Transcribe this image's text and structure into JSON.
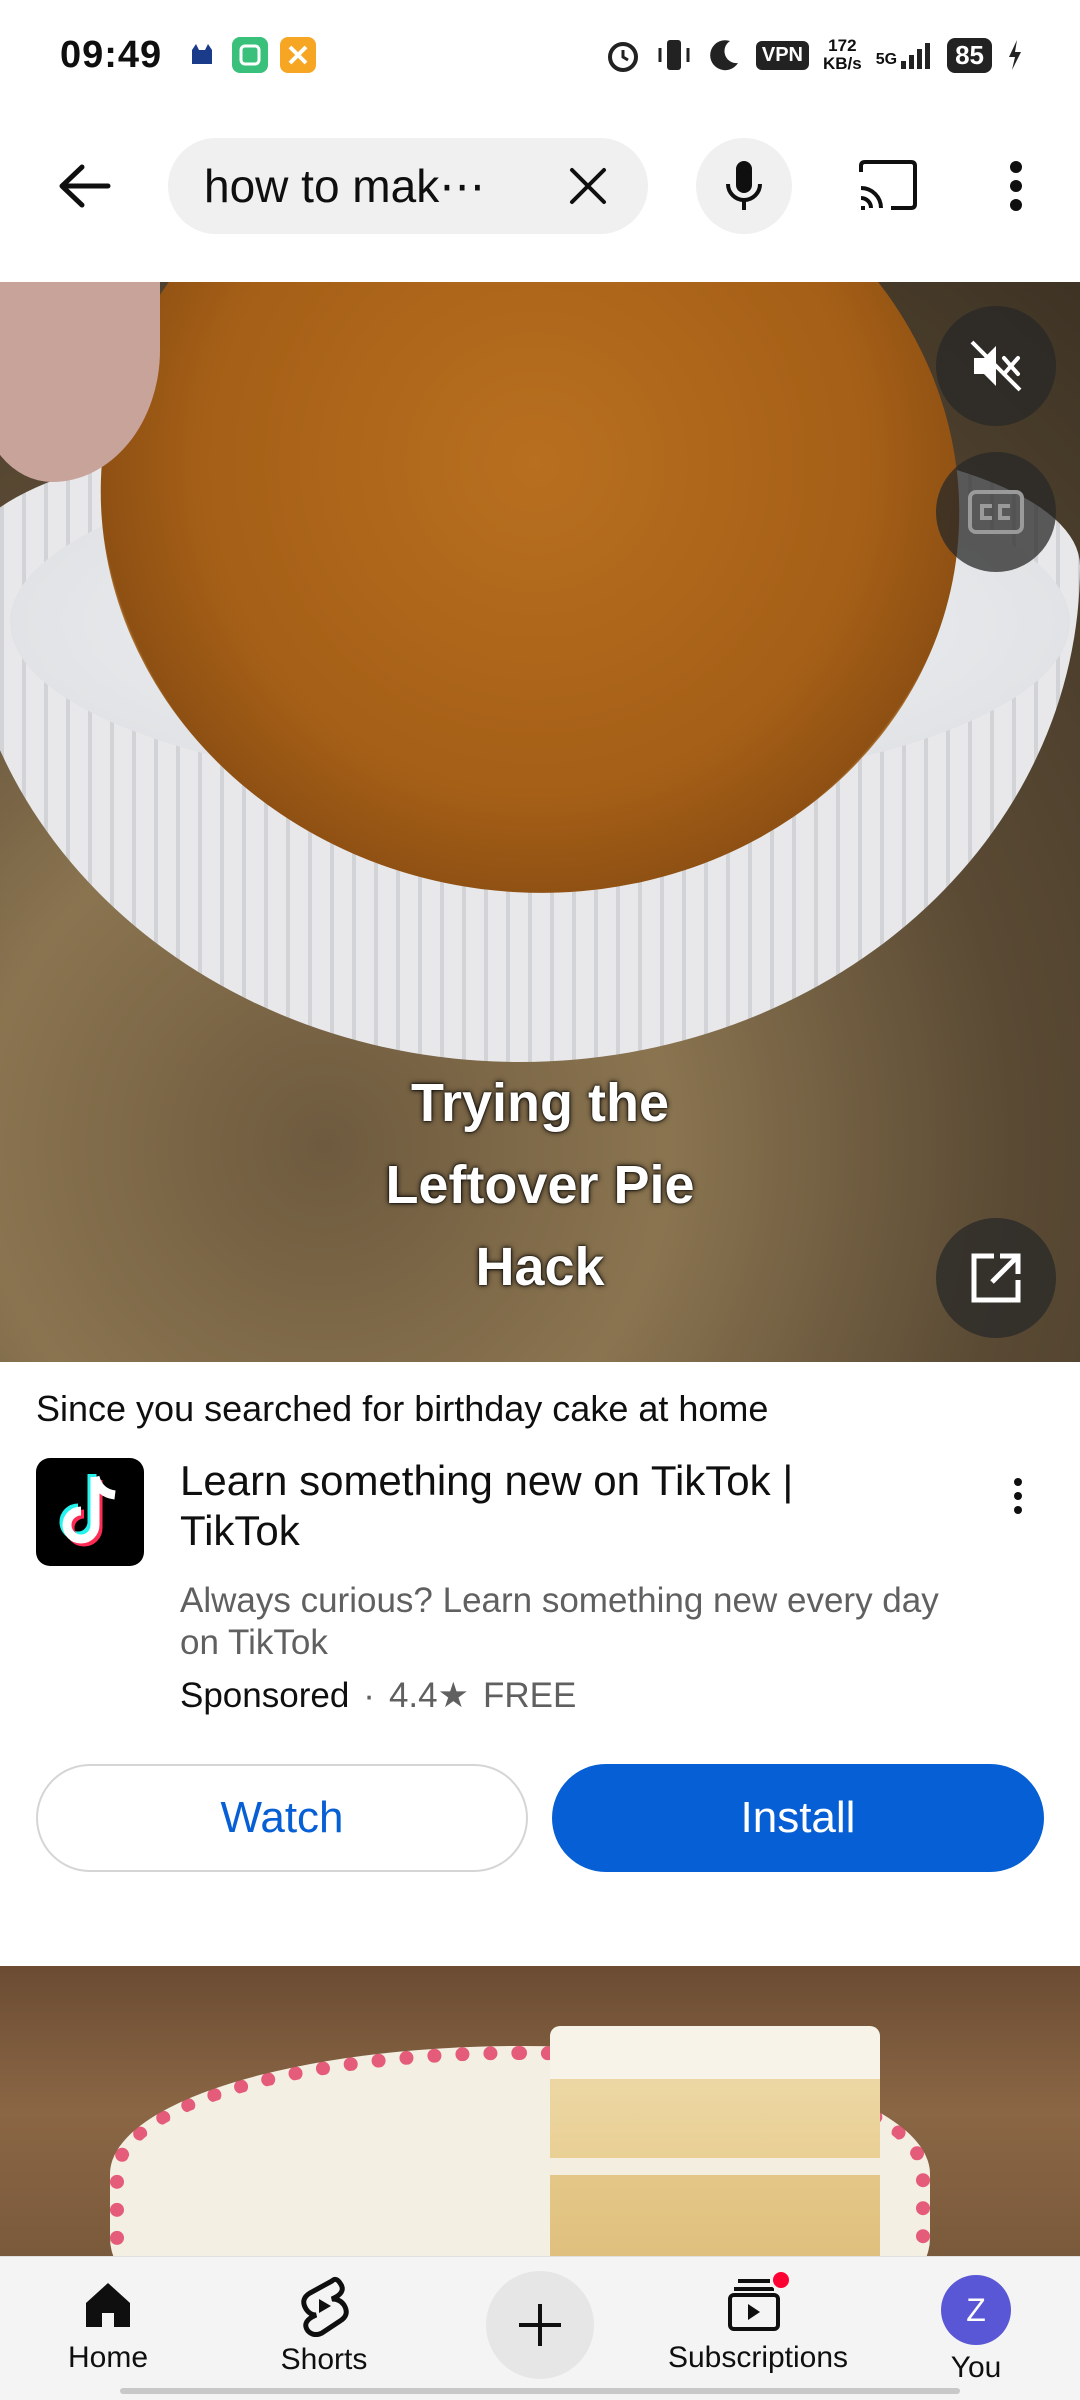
{
  "status": {
    "time": "09:49",
    "vpn": "VPN",
    "speed_value": "172",
    "speed_unit": "KB/s",
    "network": "5G",
    "battery": "85"
  },
  "topbar": {
    "search_value": "how to mak⋯"
  },
  "video": {
    "caption_line1": "Trying the",
    "caption_line2": "Leftover Pie",
    "caption_line3": "Hack"
  },
  "ad": {
    "since_prefix": "Since you searched for ",
    "since_keyword": "birthday cake at home",
    "title": "Learn something new on TikTok | TikTok",
    "description": "Always curious? Learn something new every day on TikTok",
    "sponsored": "Sponsored",
    "separator": "·",
    "rating": "4.4",
    "star": "★",
    "price": "FREE",
    "watch_label": "Watch",
    "install_label": "Install"
  },
  "nav": {
    "items": [
      {
        "label": "Home",
        "icon": "home-icon"
      },
      {
        "label": "Shorts",
        "icon": "shorts-icon"
      },
      {
        "label": "",
        "icon": "create-icon"
      },
      {
        "label": "Subscriptions",
        "icon": "subscriptions-icon"
      },
      {
        "label": "You",
        "icon": "avatar"
      }
    ],
    "avatar_letter": "Z"
  },
  "colors": {
    "accent_blue": "#065fd4",
    "avatar_purple": "#5a57d6",
    "notification_red": "#ff0033"
  }
}
